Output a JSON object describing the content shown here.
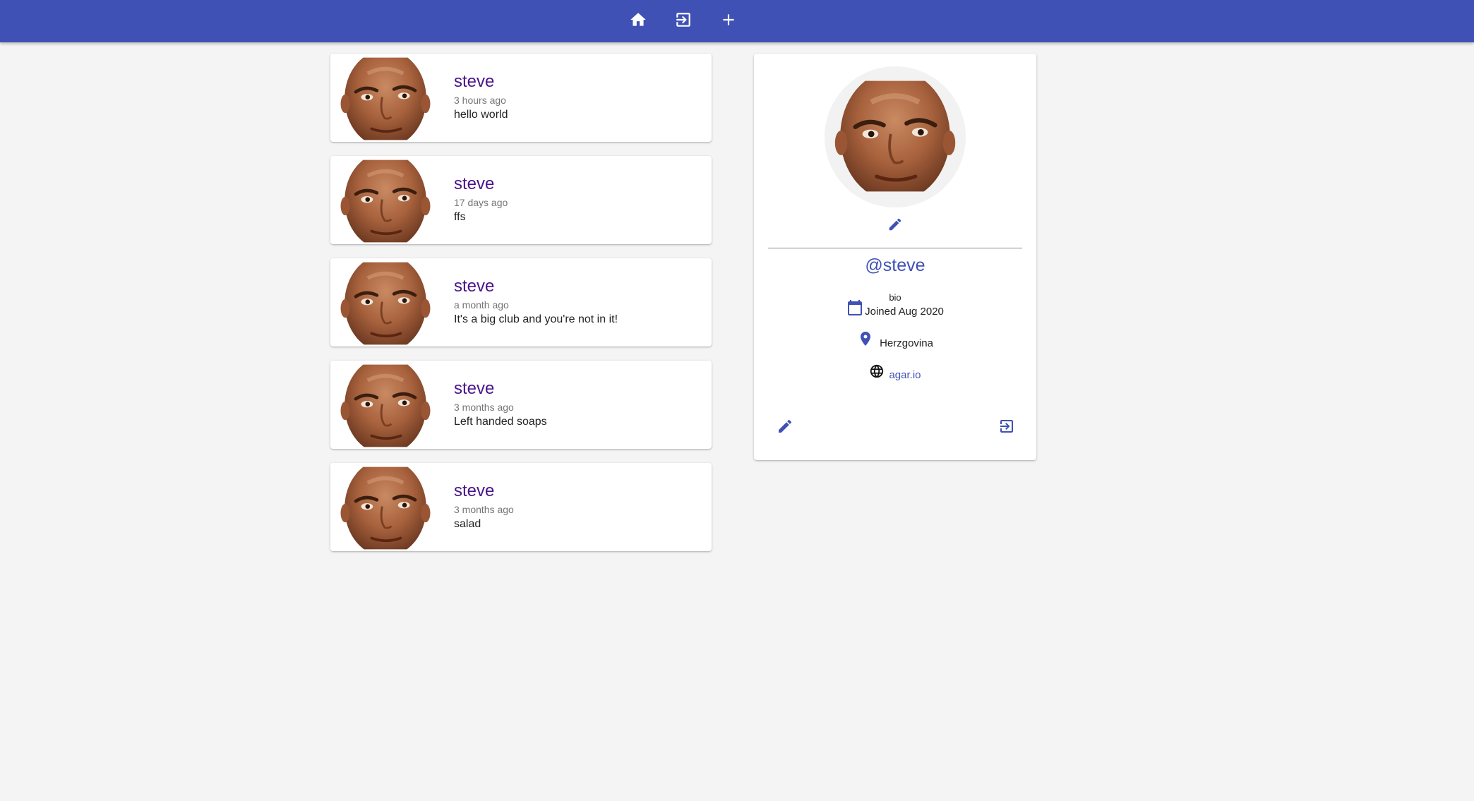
{
  "navbar": {
    "icons": [
      "home-icon",
      "login-icon",
      "add-icon"
    ],
    "bg_color": "#3f51b5"
  },
  "screams": [
    {
      "handle": "steve",
      "date": "3 hours ago",
      "body": "hello world"
    },
    {
      "handle": "steve",
      "date": "17 days ago",
      "body": "ffs"
    },
    {
      "handle": "steve",
      "date": "a month ago",
      "body": "It's a big club and you're not in it!"
    },
    {
      "handle": "steve",
      "date": "3 months ago",
      "body": "Left handed soaps"
    },
    {
      "handle": "steve",
      "date": "3 months ago",
      "body": "salad"
    }
  ],
  "profile": {
    "handle": "@steve",
    "bio": "bio",
    "joined": "Joined Aug 2020",
    "location": "Herzgovina",
    "website": "agar.io",
    "icons": {
      "edit_avatar": "pencil-icon",
      "joined": "calendar-icon",
      "location": "location-pin-icon",
      "website": "globe-icon",
      "edit_details": "pencil-icon",
      "logout": "logout-icon"
    }
  },
  "colors": {
    "primary": "#3f51b5",
    "handle": "#4a148c",
    "background": "#f4f4f4"
  }
}
